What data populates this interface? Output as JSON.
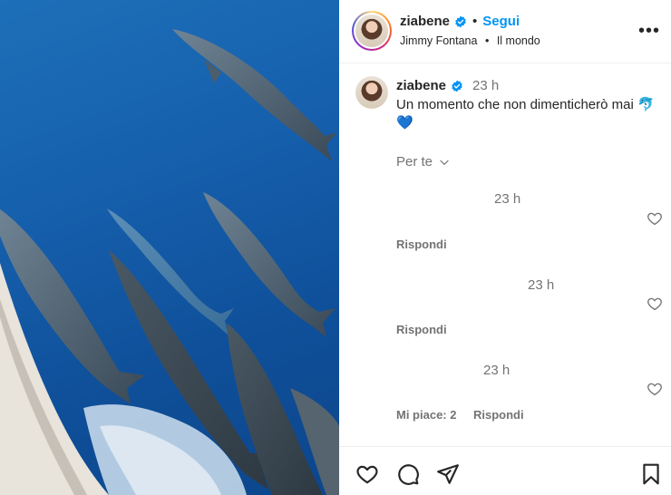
{
  "post": {
    "username": "ziabene",
    "follow_label": "Segui",
    "separator": "•",
    "music": "Jimmy Fontana",
    "music_separator": "•",
    "song": "Il mondo"
  },
  "caption": {
    "username": "ziabene",
    "time": "23 h",
    "text": "Un momento che non dimenticherò mai 🐬💙"
  },
  "sort_label": "Per te",
  "comments": [
    {
      "time": "23 h",
      "reply_label": "Rispondi"
    },
    {
      "time": "23 h",
      "reply_label": "Rispondi"
    },
    {
      "time": "23 h",
      "likes_label": "Mi piace: 2",
      "reply_label": "Rispondi"
    }
  ],
  "icons": {
    "more": "more-options-icon",
    "like": "heart-icon",
    "comment": "comment-icon",
    "share": "share-icon",
    "save": "bookmark-icon",
    "verified": "verified-badge-icon"
  },
  "colors": {
    "accent": "#0095f6",
    "verified": "#0095f6",
    "muted": "#737373"
  }
}
